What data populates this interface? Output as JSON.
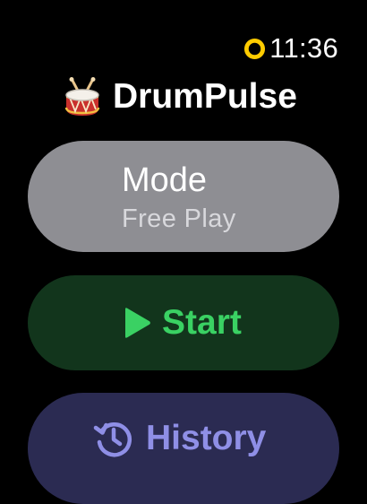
{
  "status_bar": {
    "time": "11:36",
    "indicator_icon": "activity-ring-icon",
    "indicator_color": "#ffcc00"
  },
  "app": {
    "title": "DrumPulse",
    "icon": "drum-icon"
  },
  "menu": {
    "mode": {
      "label": "Mode",
      "value": "Free Play",
      "background": "#8e8e93"
    },
    "start": {
      "label": "Start",
      "icon": "play-icon",
      "color": "#3ad163",
      "background": "#12351c"
    },
    "history": {
      "label": "History",
      "icon": "history-icon",
      "color": "#8f8fe6",
      "background": "#2b2b52"
    }
  }
}
